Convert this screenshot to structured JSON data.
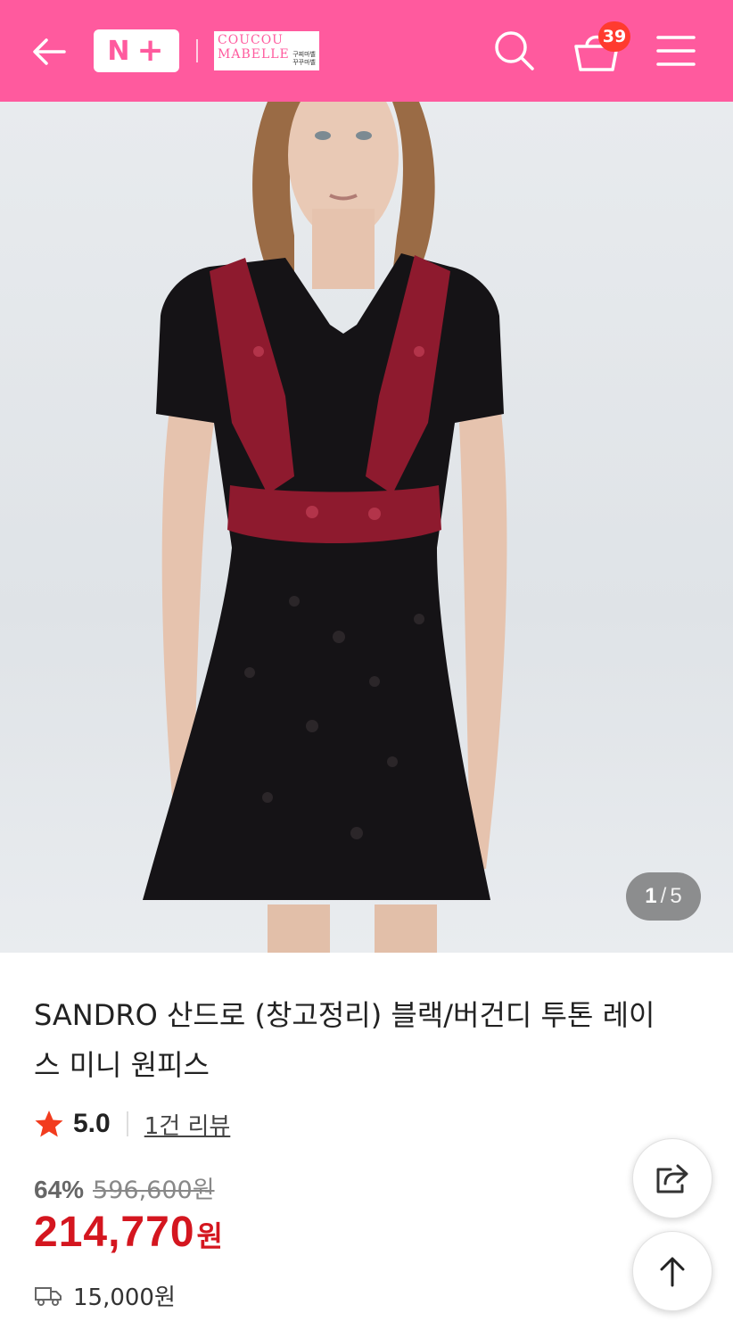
{
  "header": {
    "background_color": "#ff5a9e",
    "back_icon": "back-arrow-icon",
    "nplus_logo": "N+",
    "brand_logo_line1": "COUCOU",
    "brand_logo_line2": "MABELLE",
    "brand_logo_korean": "구찌마벨 꾸꾸마벨",
    "search_icon": "search-icon",
    "cart_icon": "shopping-basket-icon",
    "cart_count": "39",
    "menu_icon": "hamburger-menu-icon"
  },
  "gallery": {
    "current": "1",
    "separator": "/",
    "total": "5"
  },
  "product": {
    "title": "SANDRO 산드로 (창고정리) 블랙/버건디 투톤 레이스 미니 원피스",
    "rating": "5.0",
    "review_link": "1건 리뷰",
    "discount_percent": "64%",
    "original_price": "596,600원",
    "sale_price": "214,770",
    "price_unit": "원",
    "shipping_fee": "15,000원",
    "accent_color": "#d4161f"
  },
  "actions": {
    "share_icon": "share-icon",
    "scroll_top_icon": "arrow-up-icon"
  }
}
